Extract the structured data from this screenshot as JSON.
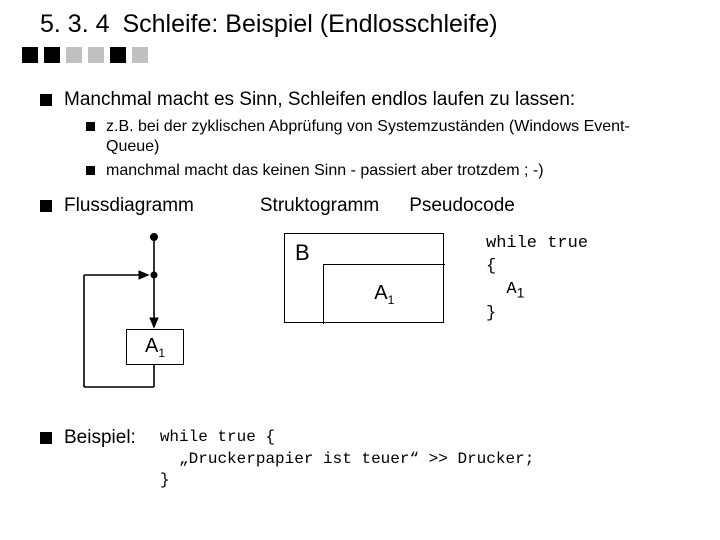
{
  "heading": {
    "number": "5. 3. 4",
    "title": "Schleife: Beispiel (Endlosschleife)"
  },
  "bullets": {
    "intro": "Manchmal macht es Sinn, Schleifen endlos laufen zu lassen:",
    "sub1": "z.B. bei der zyklischen Abprüfung von Systemzuständen (Windows Event-Queue)",
    "sub2": "manchmal macht das keinen Sinn - passiert aber trotzdem ; -)",
    "cols": {
      "a": "Flussdiagramm",
      "b": "Struktogramm",
      "c": "Pseudocode"
    },
    "example_label": "Beispiel:"
  },
  "flowchart": {
    "a1": "A"
  },
  "struktogramm": {
    "b": "B",
    "a1": "A"
  },
  "pseudocode": {
    "l1": "while true",
    "l2": "{",
    "l3": "  A",
    "l4": "}"
  },
  "example_code": {
    "l1": "while true {",
    "l2": "  „Druckerpapier ist teuer“ >> Drucker;",
    "l3": "}"
  }
}
